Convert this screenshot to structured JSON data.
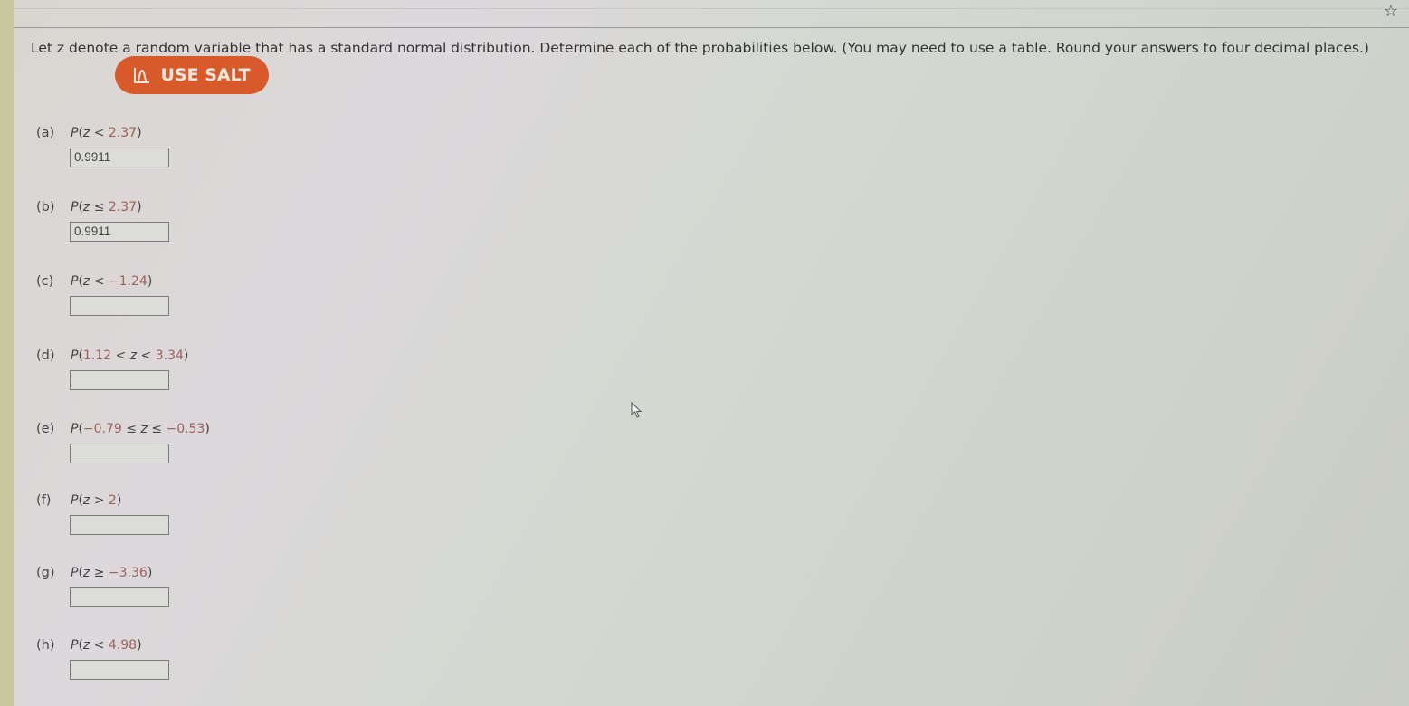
{
  "question": "Let z denote a random variable that has a standard normal distribution. Determine each of the probabilities below. (You may need to use a table. Round your answers to four decimal places.)",
  "salt_button": {
    "label": "USE SALT",
    "icon": "normal-curve-icon",
    "color": "#d85a2a"
  },
  "bookmark_icon": "star-icon",
  "parts": [
    {
      "label": "(a)",
      "prefix": "P(",
      "segments": [
        "z",
        " < ",
        "2.37",
        ")"
      ],
      "answer": "0.9911"
    },
    {
      "label": "(b)",
      "prefix": "P(",
      "segments": [
        "z",
        " ≤ ",
        "2.37",
        ")"
      ],
      "answer": "0.9911"
    },
    {
      "label": "(c)",
      "prefix": "P(",
      "segments": [
        "z",
        " < ",
        "−1.24",
        ")"
      ],
      "answer": ""
    },
    {
      "label": "(d)",
      "prefix": "P(",
      "segments": [
        "1.12",
        " < ",
        "z",
        " < ",
        "3.34",
        ")"
      ],
      "answer": ""
    },
    {
      "label": "(e)",
      "prefix": "P(",
      "segments": [
        "−0.79",
        " ≤ ",
        "z",
        " ≤ ",
        "−0.53",
        ")"
      ],
      "answer": ""
    },
    {
      "label": "(f)",
      "prefix": "P(",
      "segments": [
        "z",
        " > ",
        "2",
        ")"
      ],
      "answer": ""
    },
    {
      "label": "(g)",
      "prefix": "P(",
      "segments": [
        "z",
        " ≥ ",
        "−3.36",
        ")"
      ],
      "answer": ""
    },
    {
      "label": "(h)",
      "prefix": "P(",
      "segments": [
        "z",
        " < ",
        "4.98",
        ")"
      ],
      "answer": ""
    }
  ]
}
